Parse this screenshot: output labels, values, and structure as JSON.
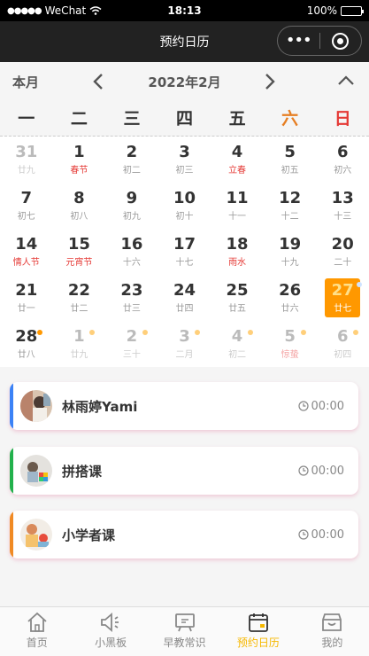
{
  "status_bar": {
    "carrier": "WeChat",
    "time": "18:13",
    "battery": "100%",
    "battery_level": 1.0
  },
  "nav": {
    "title": "预约日历"
  },
  "calendar": {
    "this_month_label": "本月",
    "month_label": "2022年2月",
    "weekdays": [
      "一",
      "二",
      "三",
      "四",
      "五",
      "六",
      "日"
    ],
    "days": [
      {
        "num": "31",
        "sub": "廿九",
        "other": true
      },
      {
        "num": "1",
        "sub": "春节",
        "red": true
      },
      {
        "num": "2",
        "sub": "初二"
      },
      {
        "num": "3",
        "sub": "初三"
      },
      {
        "num": "4",
        "sub": "立春",
        "red": true
      },
      {
        "num": "5",
        "sub": "初五"
      },
      {
        "num": "6",
        "sub": "初六"
      },
      {
        "num": "7",
        "sub": "初七"
      },
      {
        "num": "8",
        "sub": "初八"
      },
      {
        "num": "9",
        "sub": "初九"
      },
      {
        "num": "10",
        "sub": "初十"
      },
      {
        "num": "11",
        "sub": "十一"
      },
      {
        "num": "12",
        "sub": "十二"
      },
      {
        "num": "13",
        "sub": "十三"
      },
      {
        "num": "14",
        "sub": "情人节",
        "red": true
      },
      {
        "num": "15",
        "sub": "元宵节",
        "red": true
      },
      {
        "num": "16",
        "sub": "十六"
      },
      {
        "num": "17",
        "sub": "十七"
      },
      {
        "num": "18",
        "sub": "雨水",
        "red": true
      },
      {
        "num": "19",
        "sub": "十九"
      },
      {
        "num": "20",
        "sub": "二十"
      },
      {
        "num": "21",
        "sub": "廿一"
      },
      {
        "num": "22",
        "sub": "廿二"
      },
      {
        "num": "23",
        "sub": "廿三"
      },
      {
        "num": "24",
        "sub": "廿四"
      },
      {
        "num": "25",
        "sub": "廿五"
      },
      {
        "num": "26",
        "sub": "廿六"
      },
      {
        "num": "27",
        "sub": "廿七",
        "selected": true,
        "dot": true
      },
      {
        "num": "28",
        "sub": "廿八",
        "dot": true
      },
      {
        "num": "1",
        "sub": "廿九",
        "other": true,
        "dot": true
      },
      {
        "num": "2",
        "sub": "三十",
        "other": true,
        "dot": true
      },
      {
        "num": "3",
        "sub": "二月",
        "other": true,
        "dot": true
      },
      {
        "num": "4",
        "sub": "初二",
        "other": true,
        "dot": true
      },
      {
        "num": "5",
        "sub": "惊蛰",
        "other": true,
        "red": true,
        "dot": true
      },
      {
        "num": "6",
        "sub": "初四",
        "other": true,
        "dot": true
      }
    ]
  },
  "courses": [
    {
      "name": "林雨婷Yami",
      "time": "00:00",
      "color": "#3b82f6"
    },
    {
      "name": "拼搭课",
      "time": "00:00",
      "color": "#22b14c"
    },
    {
      "name": "小学者课",
      "time": "00:00",
      "color": "#f08a24"
    }
  ],
  "tabs": [
    {
      "label": "首页",
      "icon": "home-icon"
    },
    {
      "label": "小黑板",
      "icon": "megaphone-icon"
    },
    {
      "label": "早教常识",
      "icon": "easel-icon"
    },
    {
      "label": "预约日历",
      "icon": "calendar-icon",
      "active": true
    },
    {
      "label": "我的",
      "icon": "profile-box-icon"
    }
  ],
  "colors": {
    "accent": "#ff9800",
    "active_tab": "#f6b800",
    "holiday": "#e53935"
  }
}
